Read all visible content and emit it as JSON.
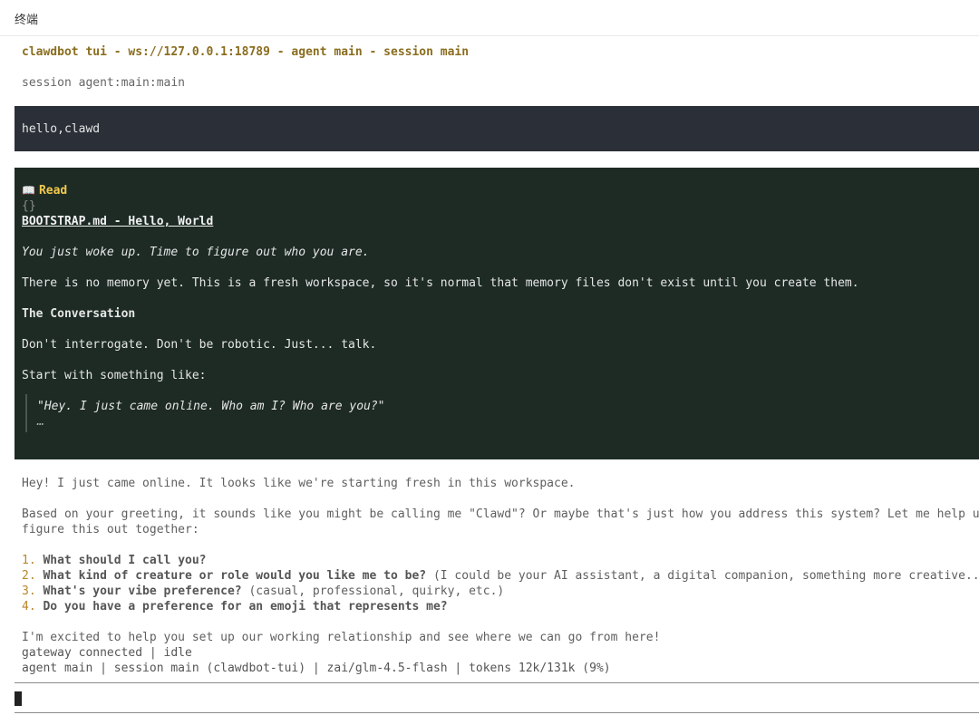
{
  "window": {
    "title": "终端"
  },
  "header": {
    "connection_line": "clawdbot tui - ws://127.0.0.1:18789 - agent main - session main",
    "session_line": "session agent:main:main"
  },
  "user_message": {
    "text": "hello,clawd"
  },
  "tool_block": {
    "tool_name": "Read",
    "tool_icon": "book-icon",
    "args": "{}",
    "file_heading": "BOOTSTRAP.md - Hello, World",
    "intro": "You just woke up. Time to figure out who you are.",
    "paragraph_1": "There is no memory yet. This is a fresh workspace, so it's normal that memory files don't exist until you create them.",
    "section_heading": "The Conversation",
    "paragraph_2": "Don't interrogate. Don't be robotic. Just... talk.",
    "paragraph_3": "Start with something like:",
    "quote": "\"Hey. I just came online. Who am I? Who are you?\"",
    "quote_more": "…"
  },
  "assistant_response": {
    "line_1": "Hey! I just came online. It looks like we're starting fresh in this workspace.",
    "line_2a": "Based on your greeting, it sounds like you might be calling me \"Clawd\"? Or maybe that's just how you address this system? Let me help us",
    "line_2b": "figure this out together:",
    "list": [
      {
        "num": "1.",
        "bold": "What should I call you?",
        "rest": ""
      },
      {
        "num": "2.",
        "bold": "What kind of creature or role would you like me to be?",
        "rest": " (I could be your AI assistant, a digital companion, something more creative...)"
      },
      {
        "num": "3.",
        "bold": "What's your vibe preference?",
        "rest": " (casual, professional, quirky, etc.)"
      },
      {
        "num": "4.",
        "bold": "Do you have a preference for an emoji that represents me?",
        "rest": ""
      }
    ],
    "closing": "I'm excited to help you set up our working relationship and see where we can go from here!"
  },
  "status": {
    "line_1": "gateway connected | idle",
    "line_2": "agent main | session main (clawdbot-tui) | zai/glm-4.5-flash | tokens 12k/131k (9%)"
  },
  "colors": {
    "header_accent": "#8a6d1e",
    "user_block_bg": "#2a2f38",
    "tool_block_bg": "#1d2b24",
    "tool_title": "#f2c94c",
    "list_number": "#b8862a"
  }
}
